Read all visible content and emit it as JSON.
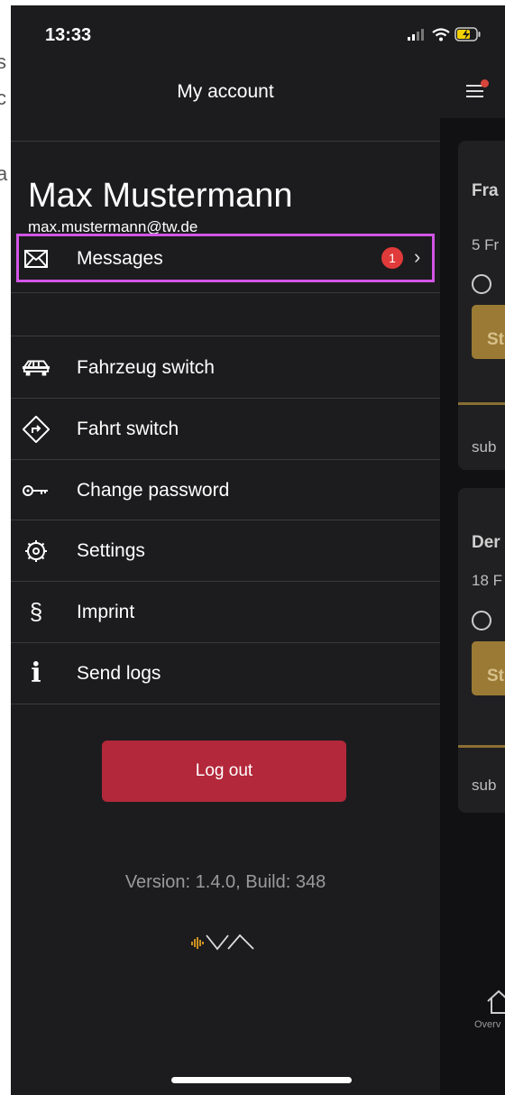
{
  "status_bar": {
    "time": "13:33"
  },
  "drawer": {
    "title": "My account",
    "user": {
      "name": "Max Mustermann",
      "email": "max.mustermann@tw.de"
    },
    "messages": {
      "label": "Messages",
      "badge": "1"
    },
    "menu": [
      {
        "label": "Fahrzeug switch",
        "icon": "car-icon"
      },
      {
        "label": "Fahrt switch",
        "icon": "route-turn-icon"
      },
      {
        "label": "Change password",
        "icon": "key-icon"
      },
      {
        "label": "Settings",
        "icon": "gear-icon"
      },
      {
        "label": "Imprint",
        "icon": "section-sign-icon"
      },
      {
        "label": "Send logs",
        "icon": "info-icon"
      }
    ],
    "logout_label": "Log out",
    "version": "Version: 1.4.0, Build: 348"
  },
  "background_page": {
    "cards": [
      {
        "title": "Fra",
        "date": "5 Fr",
        "button": "St",
        "footer": "sub"
      },
      {
        "title": "Der",
        "date": "18 F",
        "button": "St",
        "footer": "sub"
      }
    ],
    "nav_overview_label": "Overv"
  },
  "left_edge_fragments": [
    "s",
    "c",
    "a"
  ],
  "colors": {
    "accent_logout": "#b3283a",
    "highlight_border": "#d255e6",
    "badge": "#e03a3a",
    "gold": "#9a7a35"
  }
}
